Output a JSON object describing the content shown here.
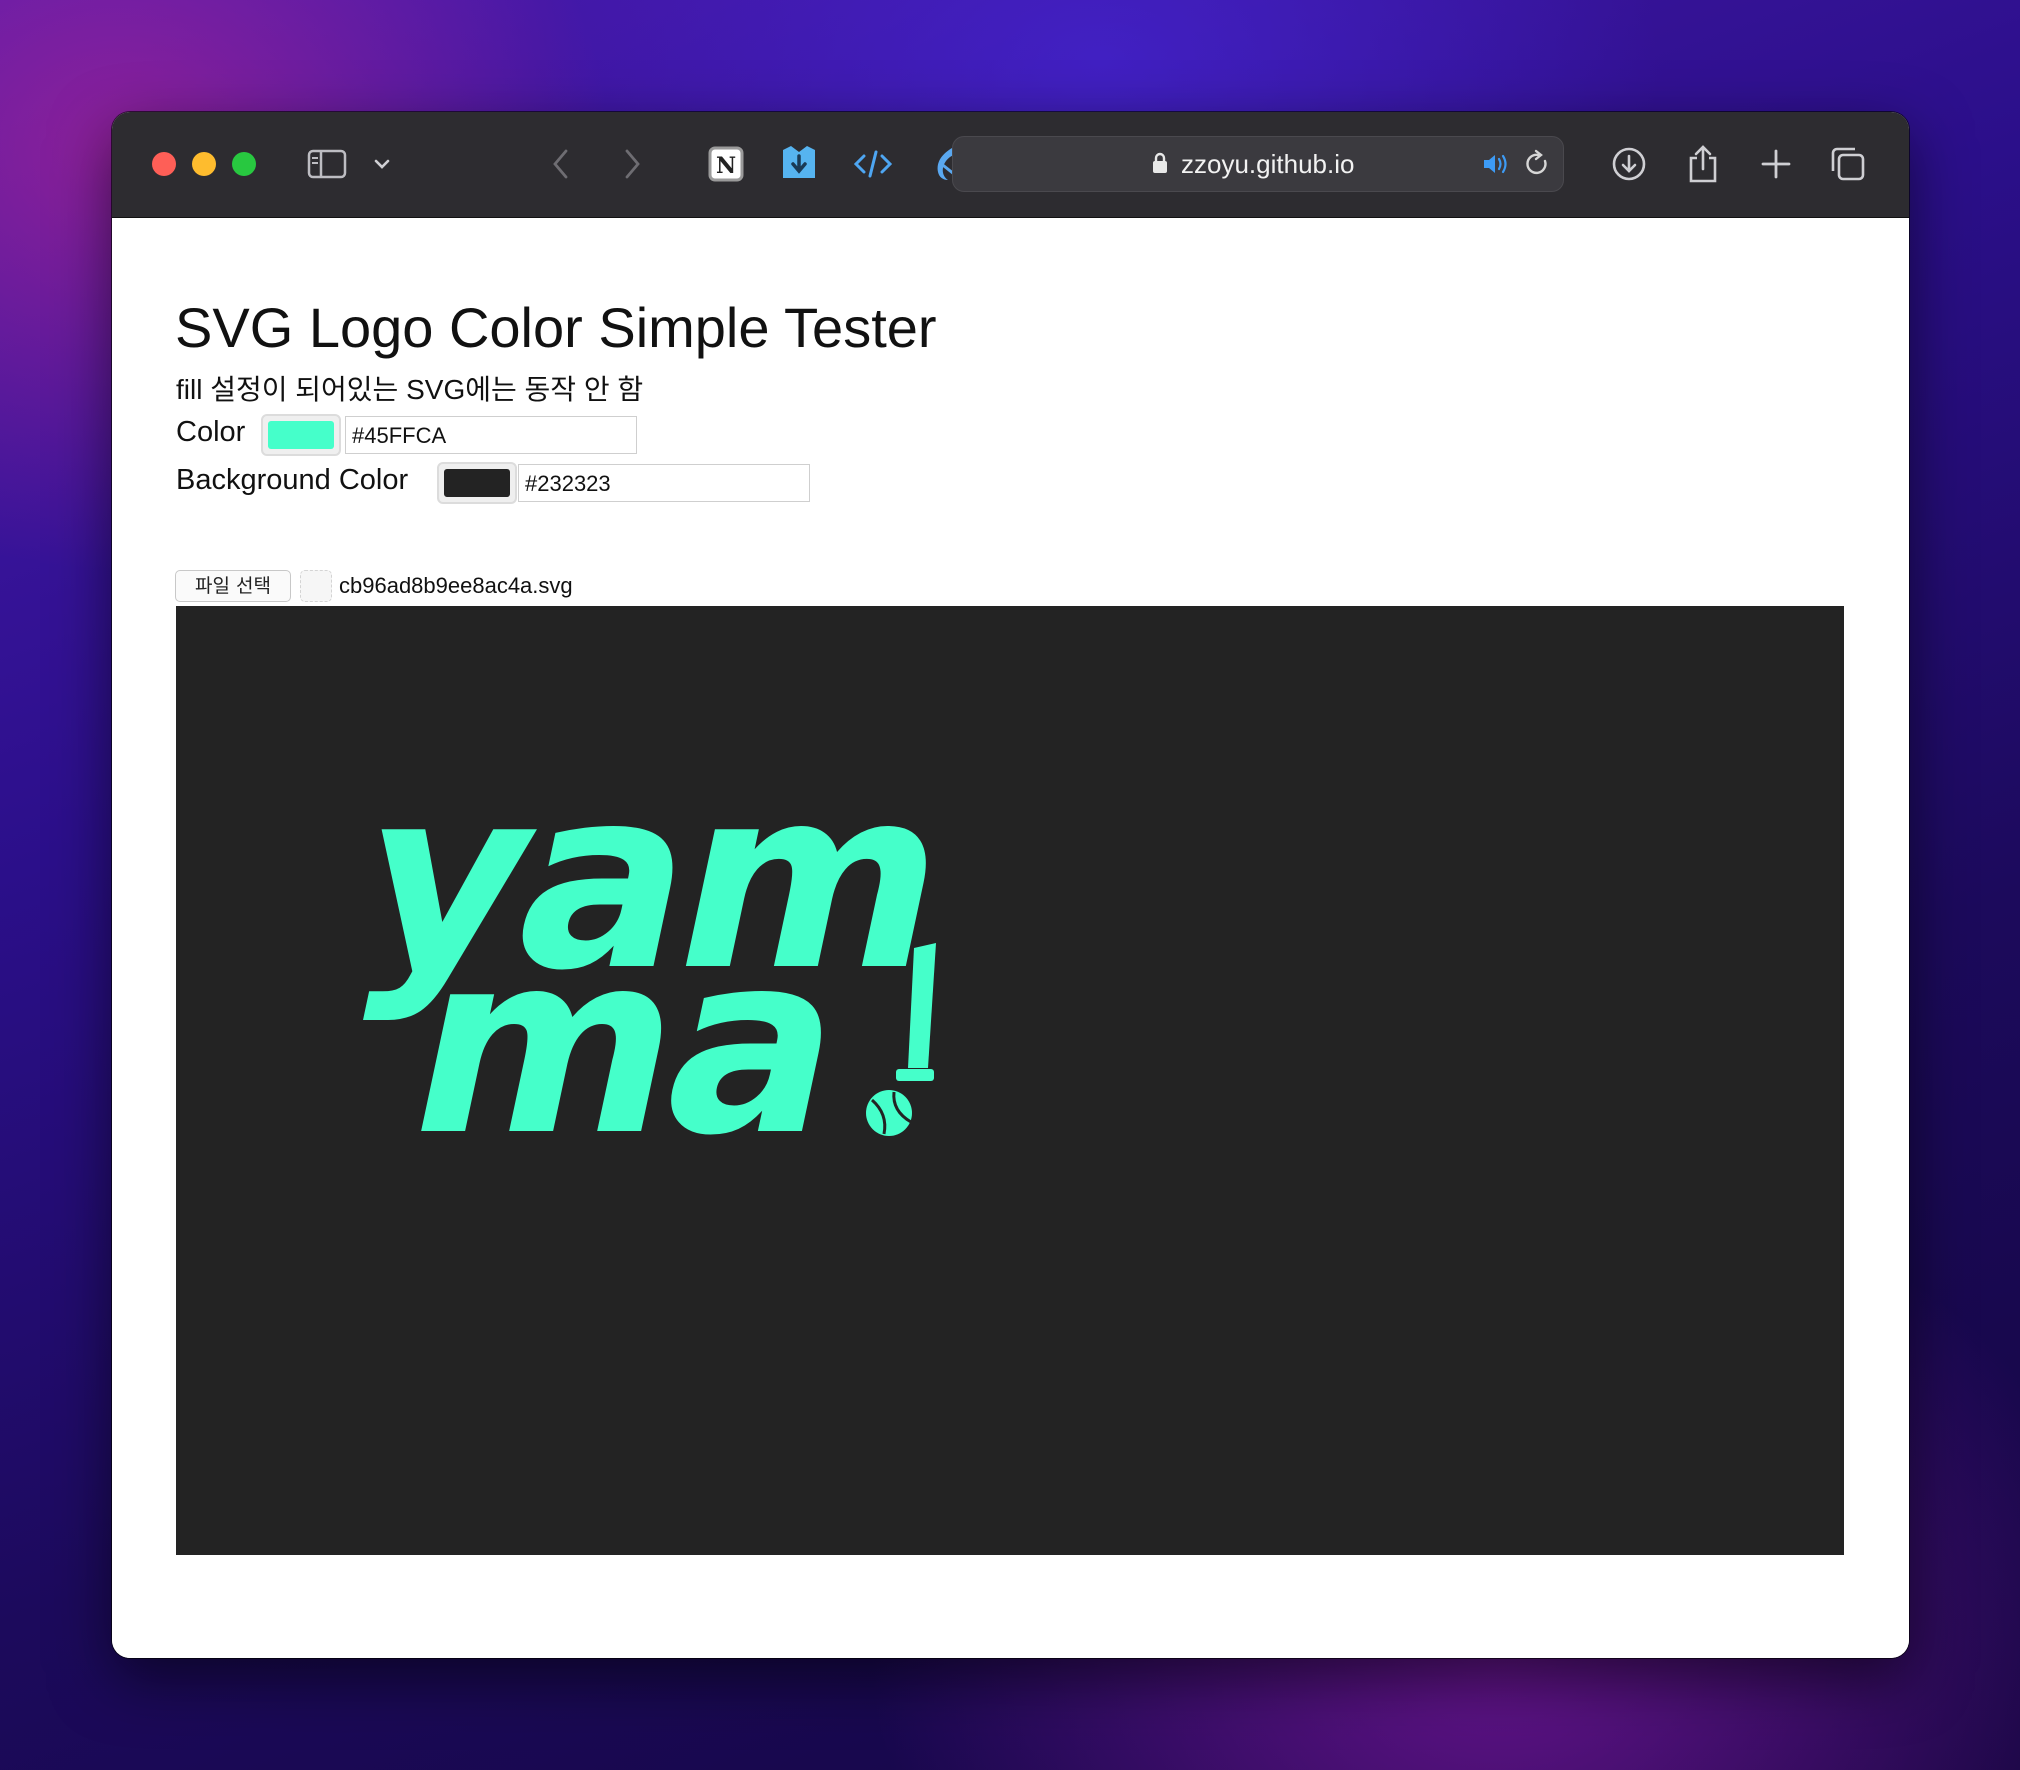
{
  "browser": {
    "url": "zzoyu.github.io",
    "bookmarks": [
      "notion-icon",
      "download-helper-icon",
      "code-icon",
      "bird-icon",
      "vuetify-icon"
    ]
  },
  "page": {
    "title": "SVG Logo Color Simple Tester",
    "note": "fill 설정이 되어있는 SVG에는 동작 안 함",
    "color_label": "Color",
    "color_value": "#45FFCA",
    "bg_label": "Background Color",
    "bg_value": "#232323",
    "file_button": "파일 선택",
    "file_name": "cb96ad8b9ee8ac4a.svg"
  },
  "logo": {
    "line1": "yam",
    "line2": "ma",
    "mark": "!"
  },
  "colors": {
    "fill": "#45FFCA",
    "background": "#232323"
  }
}
